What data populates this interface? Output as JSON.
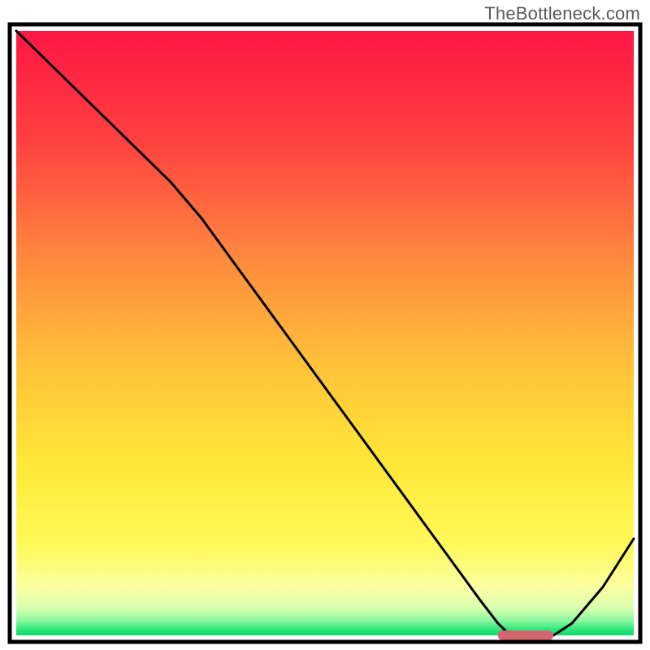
{
  "watermark": "TheBottleneck.com",
  "chart_data": {
    "type": "line",
    "title": "",
    "xlabel": "",
    "ylabel": "",
    "x": [
      0.0,
      0.05,
      0.1,
      0.15,
      0.2,
      0.25,
      0.3,
      0.35,
      0.4,
      0.45,
      0.5,
      0.55,
      0.6,
      0.65,
      0.7,
      0.75,
      0.78,
      0.8,
      0.83,
      0.87,
      0.9,
      0.95,
      1.0
    ],
    "values": [
      1.0,
      0.95,
      0.9,
      0.85,
      0.8,
      0.75,
      0.69,
      0.62,
      0.55,
      0.48,
      0.41,
      0.34,
      0.27,
      0.2,
      0.13,
      0.06,
      0.02,
      0.0,
      0.0,
      0.0,
      0.02,
      0.08,
      0.16
    ],
    "highlight_segment_x": [
      0.78,
      0.87
    ],
    "highlight_segment_y": 0.0,
    "xlim": [
      0.0,
      1.0
    ],
    "ylim": [
      0.0,
      1.0
    ],
    "gradient_stops": [
      {
        "offset": 0.0,
        "color": "#ff1744"
      },
      {
        "offset": 0.18,
        "color": "#ff4040"
      },
      {
        "offset": 0.38,
        "color": "#ff8a3d"
      },
      {
        "offset": 0.55,
        "color": "#ffc13a"
      },
      {
        "offset": 0.72,
        "color": "#ffe838"
      },
      {
        "offset": 0.85,
        "color": "#fff95a"
      },
      {
        "offset": 0.92,
        "color": "#fbffa0"
      },
      {
        "offset": 0.955,
        "color": "#d9ffb0"
      },
      {
        "offset": 0.975,
        "color": "#8ef7a0"
      },
      {
        "offset": 0.99,
        "color": "#2ee87a"
      },
      {
        "offset": 1.0,
        "color": "#12d86a"
      }
    ],
    "highlight_color": "#d4646e",
    "line_color": "#000000",
    "border_color": "#000000"
  },
  "plot": {
    "outer_x": 12,
    "outer_y": 30,
    "outer_w": 776,
    "outer_h": 760,
    "inner_pad": 8
  }
}
